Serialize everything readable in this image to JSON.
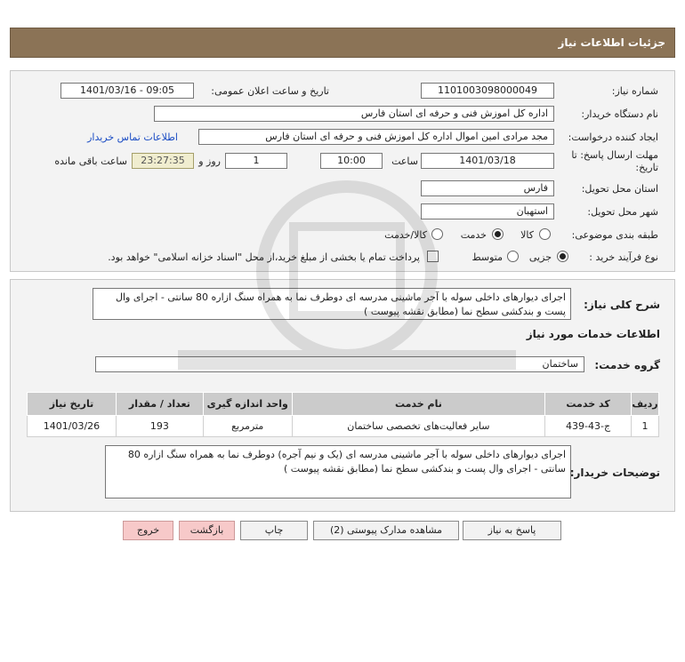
{
  "header": {
    "title": "جزئیات اطلاعات نیاز"
  },
  "form": {
    "need_number_label": "شماره نیاز:",
    "need_number": "1101003098000049",
    "announce_label": "تاریخ و ساعت اعلان عمومی:",
    "announce_value": "1401/03/16 - 09:05",
    "buyer_label": "نام دستگاه خریدار:",
    "buyer_value": "اداره کل اموزش فنی و حرفه ای استان فارس",
    "creator_label": "ایجاد کننده درخواست:",
    "creator_value": "مجد مرادی امین  اموال اداره کل اموزش فنی و حرفه ای استان فارس",
    "contact_link": "اطلاعات تماس خریدار",
    "deadline_label_1": "مهلت ارسال پاسخ: تا",
    "deadline_label_2": "تاریخ:",
    "deadline_date": "1401/03/18",
    "time_label": "ساعت",
    "deadline_time": "10:00",
    "days_value": "1",
    "days_label": "روز و",
    "remaining_time": "23:27:35",
    "remaining_label": "ساعت باقی مانده",
    "province_label": "استان محل تحویل:",
    "province_value": "فارس",
    "city_label": "شهر محل تحویل:",
    "city_value": "استهبان",
    "category_label": "طبقه بندی موضوعی:",
    "category_options": [
      "کالا",
      "خدمت",
      "کالا/خدمت"
    ],
    "category_selected": "خدمت",
    "process_label": "نوع فرآیند خرید :",
    "process_options": [
      "جزیی",
      "متوسط"
    ],
    "process_selected": "جزیی",
    "payment_note": "پرداخت تمام یا بخشی از مبلغ خرید،از محل \"اسناد خزانه اسلامی\" خواهد بود."
  },
  "details": {
    "description_label": "شرح کلی نیاز:",
    "description": "اجرای دیوارهای داخلی سوله با آجر ماشینی مدرسه ای  دوطرف نما به  همراه  سنگ ازاره 80 سانتی - اجرای وال پست و بندکشی سطح نما (مطابق  نقشه پیوست )",
    "services_title": "اطلاعات خدمات مورد نیاز",
    "service_group_label": "گروه خدمت:",
    "service_group": "ساختمان",
    "table_headers": [
      "ردیف",
      "کد خدمت",
      "نام خدمت",
      "واحد اندازه گیری",
      "تعداد / مقدار",
      "تاریخ نیاز"
    ],
    "table_rows": [
      [
        "1",
        "ج-43-439",
        "سایر فعالیت‌های تخصصی ساختمان",
        "مترمربع",
        "193",
        "1401/03/26"
      ]
    ],
    "buyer_notes_label": "توضیحات خریدار:",
    "buyer_notes": "اجرای دیوارهای داخلی سوله با آجر ماشینی مدرسه ای (یک و نیم آجره) دوطرف نما به  همراه  سنگ ازاره 80 سانتی - اجرای وال پست و بندکشی سطح نما (مطابق  نقشه پیوست )"
  },
  "buttons": {
    "reply": "پاسخ به نیاز",
    "attachments": "مشاهده مدارک پیوستی (2)",
    "print": "چاپ",
    "back": "بازگشت",
    "exit": "خروج"
  },
  "colors": {
    "header_bg": "#8b7356",
    "panel_bg": "#f3f3f3",
    "link": "#1a4cc4"
  }
}
